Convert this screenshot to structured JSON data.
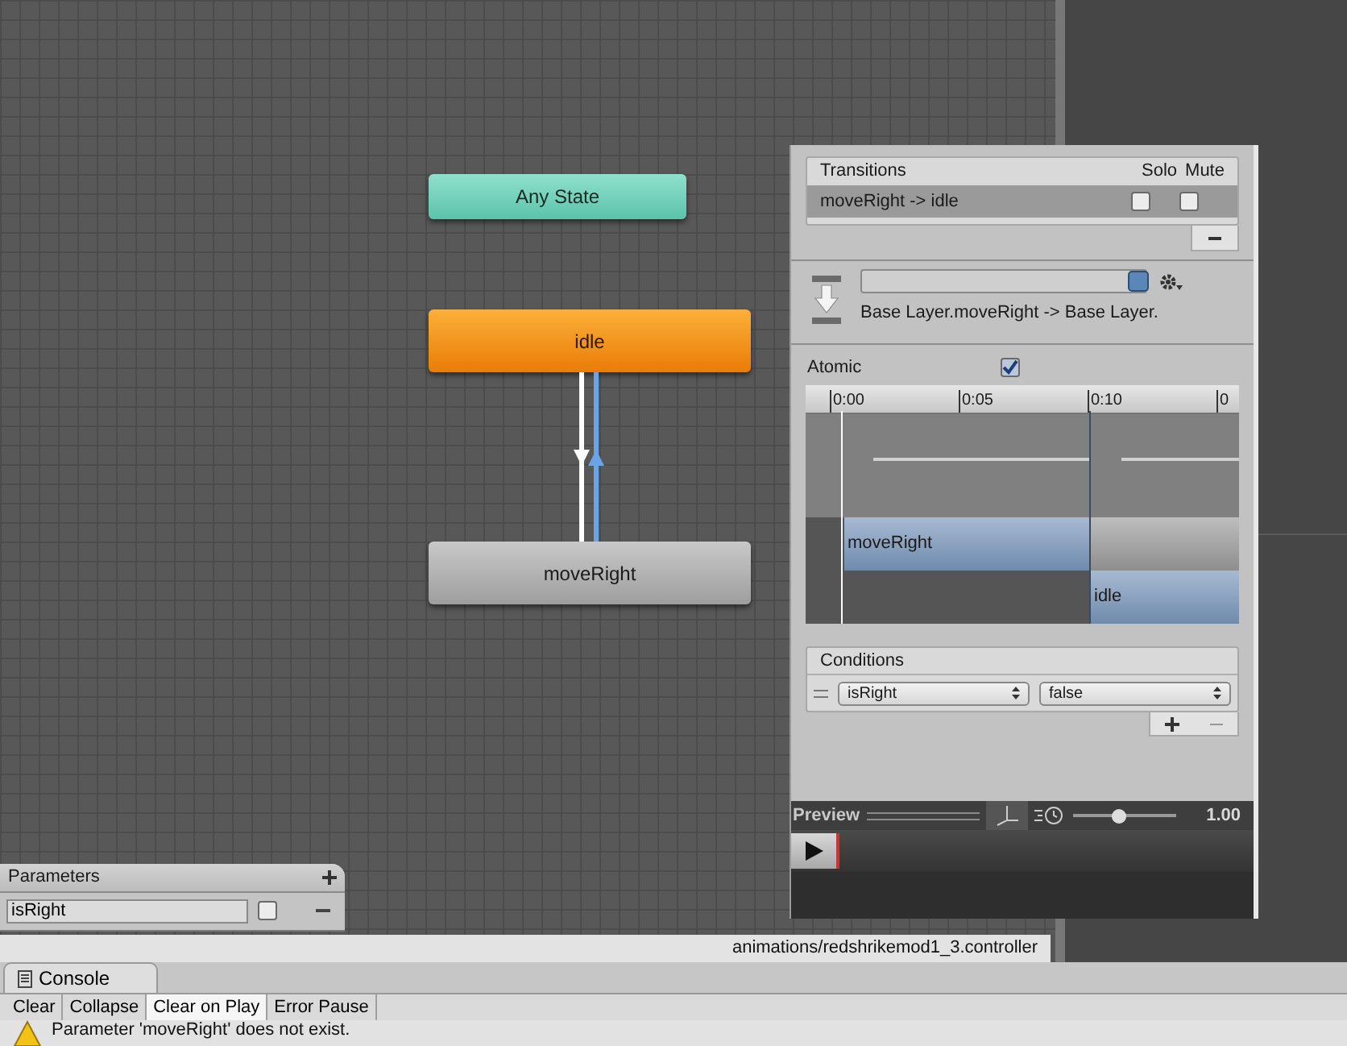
{
  "canvas": {
    "nodes": [
      {
        "label": "Any State",
        "kind": "any"
      },
      {
        "label": "idle",
        "kind": "default"
      },
      {
        "label": "moveRight",
        "kind": "normal"
      }
    ]
  },
  "parameters": {
    "title": "Parameters",
    "items": [
      {
        "name": "isRight",
        "checked": false
      }
    ]
  },
  "inspector": {
    "transitions": {
      "title": "Transitions",
      "columns": [
        "Solo",
        "Mute"
      ],
      "rows": [
        {
          "name": "moveRight -> idle",
          "selected": true,
          "solo": false,
          "mute": false
        }
      ]
    },
    "transition_name": "Base Layer.moveRight -> Base Layer.",
    "atomic": {
      "label": "Atomic",
      "checked": true
    },
    "timeline": {
      "ticks": [
        "0:00",
        "0:05",
        "0:10",
        "0"
      ],
      "clips": [
        {
          "label": "moveRight"
        },
        {
          "label": "idle"
        }
      ]
    },
    "conditions": {
      "title": "Conditions",
      "items": [
        {
          "parameter": "isRight",
          "value": "false"
        }
      ]
    },
    "preview": {
      "title": "Preview",
      "speed": "1.00",
      "level": 0.45
    }
  },
  "status_bar": {
    "path": "animations/redshrikemod1_3.controller"
  },
  "console": {
    "tab": "Console",
    "buttons": [
      {
        "label": "Clear",
        "selected": false
      },
      {
        "label": "Collapse",
        "selected": false
      },
      {
        "label": "Clear on Play",
        "selected": true
      },
      {
        "label": "Error Pause",
        "selected": false
      }
    ],
    "messages": [
      {
        "text": "Parameter 'moveRight' does not exist.",
        "kind": "warning"
      }
    ]
  }
}
